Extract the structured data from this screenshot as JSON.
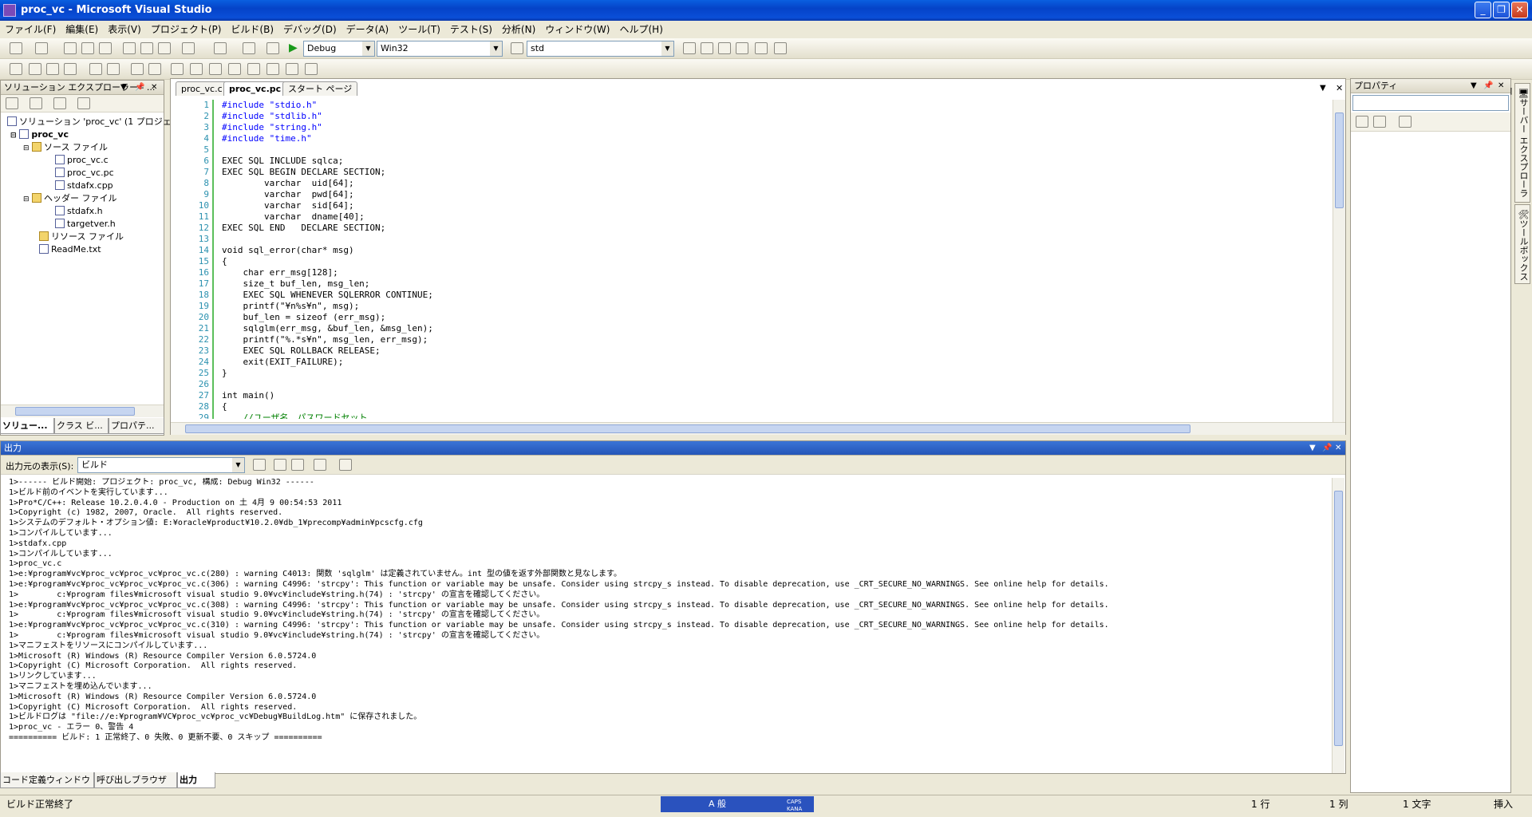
{
  "window": {
    "title": "proc_vc - Microsoft Visual Studio"
  },
  "menu": [
    "ファイル(F)",
    "編集(E)",
    "表示(V)",
    "プロジェクト(P)",
    "ビルド(B)",
    "デバッグ(D)",
    "データ(A)",
    "ツール(T)",
    "テスト(S)",
    "分析(N)",
    "ウィンドウ(W)",
    "ヘルプ(H)"
  ],
  "toolbar": {
    "config": "Debug",
    "platform": "Win32",
    "find": "std"
  },
  "solution_explorer": {
    "title": "ソリューション エクスプローラー - ...",
    "items": [
      "ソリューション 'proc_vc' (1 プロジェクト",
      "proc_vc",
      "ソース ファイル",
      "proc_vc.c",
      "proc_vc.pc",
      "stdafx.cpp",
      "ヘッダー ファイル",
      "stdafx.h",
      "targetver.h",
      "リソース ファイル",
      "ReadMe.txt"
    ],
    "bottom_tabs": [
      "ソリュー...",
      "クラス ビ...",
      "プロパテ..."
    ]
  },
  "editor": {
    "tabs": [
      "proc_vc.c",
      "proc_vc.pc",
      "スタート ページ"
    ],
    "lines": [
      "#include \"stdio.h\"",
      "#include \"stdlib.h\"",
      "#include \"string.h\"",
      "#include \"time.h\"",
      "",
      "EXEC SQL INCLUDE sqlca;",
      "EXEC SQL BEGIN DECLARE SECTION;",
      "        varchar  uid[64];",
      "        varchar  pwd[64];",
      "        varchar  sid[64];",
      "        varchar  dname[40];",
      "EXEC SQL END   DECLARE SECTION;",
      "",
      "void sql_error(char* msg)",
      "{",
      "    char err_msg[128];",
      "    size_t buf_len, msg_len;",
      "    EXEC SQL WHENEVER SQLERROR CONTINUE;",
      "    printf(\"¥n%s¥n\", msg);",
      "    buf_len = sizeof (err_msg);",
      "    sqlglm(err_msg, &buf_len, &msg_len);",
      "    printf(\"%.*s¥n\", msg_len, err_msg);",
      "    EXEC SQL ROLLBACK RELEASE;",
      "    exit(EXIT_FAILURE);",
      "}",
      "",
      "int main()",
      "{",
      "    //ユーザ名、パスワードセット"
    ]
  },
  "properties": {
    "title": "プロパティ"
  },
  "side_tabs": [
    "サーバー エクスプローラー",
    "ツールボックス"
  ],
  "output": {
    "title": "出力",
    "source_label": "出力元の表示(S):",
    "source_value": "ビルド",
    "lines": [
      "1>------ ビルド開始: プロジェクト: proc_vc, 構成: Debug Win32 ------",
      "1>ビルド前のイベントを実行しています...",
      "1>Pro*C/C++: Release 10.2.0.4.0 - Production on 土 4月 9 00:54:53 2011",
      "1>Copyright (c) 1982, 2007, Oracle.  All rights reserved.",
      "1>システムのデフォルト・オプション値: E:¥oracle¥product¥10.2.0¥db_1¥precomp¥admin¥pcscfg.cfg",
      "1>コンパイルしています...",
      "1>stdafx.cpp",
      "1>コンパイルしています...",
      "1>proc_vc.c",
      "1>e:¥program¥vc¥proc_vc¥proc_vc¥proc_vc.c(280) : warning C4013: 関数 'sqlglm' は定義されていません。int 型の値を返す外部関数と見なします。",
      "1>e:¥program¥vc¥proc_vc¥proc_vc¥proc_vc.c(306) : warning C4996: 'strcpy': This function or variable may be unsafe. Consider using strcpy_s instead. To disable deprecation, use _CRT_SECURE_NO_WARNINGS. See online help for details.",
      "1>        c:¥program files¥microsoft visual studio 9.0¥vc¥include¥string.h(74) : 'strcpy' の宣言を確認してください。",
      "1>e:¥program¥vc¥proc_vc¥proc_vc¥proc_vc.c(308) : warning C4996: 'strcpy': This function or variable may be unsafe. Consider using strcpy_s instead. To disable deprecation, use _CRT_SECURE_NO_WARNINGS. See online help for details.",
      "1>        c:¥program files¥microsoft visual studio 9.0¥vc¥include¥string.h(74) : 'strcpy' の宣言を確認してください。",
      "1>e:¥program¥vc¥proc_vc¥proc_vc¥proc_vc.c(310) : warning C4996: 'strcpy': This function or variable may be unsafe. Consider using strcpy_s instead. To disable deprecation, use _CRT_SECURE_NO_WARNINGS. See online help for details.",
      "1>        c:¥program files¥microsoft visual studio 9.0¥vc¥include¥string.h(74) : 'strcpy' の宣言を確認してください。",
      "1>マニフェストをリソースにコンパイルしています...",
      "1>Microsoft (R) Windows (R) Resource Compiler Version 6.0.5724.0",
      "1>Copyright (C) Microsoft Corporation.  All rights reserved.",
      "1>リンクしています...",
      "1>マニフェストを埋め込んでいます...",
      "1>Microsoft (R) Windows (R) Resource Compiler Version 6.0.5724.0",
      "1>Copyright (C) Microsoft Corporation.  All rights reserved.",
      "1>ビルドログは \"file://e:¥program¥VC¥proc_vc¥proc_vc¥Debug¥BuildLog.htm\" に保存されました。",
      "1>proc_vc - エラー 0、警告 4",
      "========== ビルド: 1 正常終了、0 失敗、0 更新不要、0 スキップ =========="
    ],
    "bottom_tabs": [
      "コード定義ウィンドウ",
      "呼び出しブラウザ",
      "出力"
    ]
  },
  "status": {
    "text": "ビルド正常終了",
    "ime": "A 般",
    "caps": "CAPS",
    "kana": "KANA",
    "line": "1 行",
    "col": "1 列",
    "char": "1 文字",
    "mode": "挿入"
  },
  "colors": {
    "title_bar": "#0a4fd8",
    "keyword": "#0000ff",
    "string": "#a31515",
    "comment": "#008000",
    "line_number": "#2b91af"
  }
}
